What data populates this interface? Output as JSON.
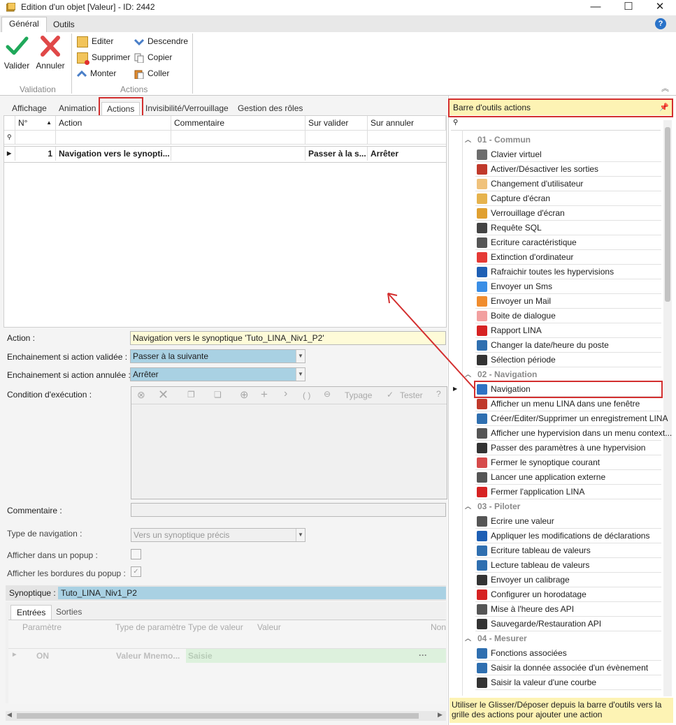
{
  "window": {
    "title": "Edition d'un objet [Valeur] - ID: 2442",
    "minimize": "—",
    "maximize": "☐",
    "close": "✕"
  },
  "ribbon": {
    "tabs": [
      "Général",
      "Outils"
    ],
    "help": "?",
    "validation": {
      "valider": "Valider",
      "annuler": "Annuler",
      "group": "Validation"
    },
    "actions": {
      "editer": "Editer",
      "supprimer": "Supprimer",
      "monter": "Monter",
      "descendre": "Descendre",
      "copier": "Copier",
      "coller": "Coller",
      "group": "Actions"
    }
  },
  "tabs": [
    "Affichage",
    "Animation",
    "Actions",
    "Invisibilité/Verrouillage",
    "Gestion des rôles"
  ],
  "grid": {
    "headers": [
      "N°",
      "Action",
      "Commentaire",
      "Sur valider",
      "Sur annuler"
    ],
    "row": {
      "num": "1",
      "action": "Navigation vers le synopti...",
      "commentaire": "",
      "sur_valider": "Passer à la s...",
      "sur_annuler": "Arrêter"
    }
  },
  "form": {
    "action_label": "Action :",
    "action_value": "Navigation vers le synoptique 'Tuto_LINA_Niv1_P2'",
    "ench_valid_label": "Enchainement si action validée :",
    "ench_valid_value": "Passer à la suivante",
    "ench_annul_label": "Enchainement si action annulée :",
    "ench_annul_value": "Arrêter",
    "condition_label": "Condition d'exécution :",
    "cond_toolbar": {
      "paren": "( )",
      "typage": "Typage",
      "tester": "Tester"
    },
    "commentaire_label": "Commentaire :",
    "type_nav_label": "Type de navigation :",
    "type_nav_value": "Vers un synoptique précis",
    "popup_label": "Afficher dans un popup :",
    "bordures_label": "Afficher les bordures du popup :",
    "synoptique_label": "Synoptique :",
    "synoptique_value": "Tuto_LINA_Niv1_P2",
    "subtabs": [
      "Entrées",
      "Sorties"
    ],
    "params_headers": [
      "Paramètre",
      "Type de paramètre",
      "Type de valeur",
      "Valeur",
      "Non"
    ],
    "params_row": {
      "param": "ON",
      "type_param": "Valeur Mnemo...",
      "type_valeur": "Saisie",
      "valeur": "",
      "more": "···"
    }
  },
  "panel": {
    "title": "Barre d'outils actions",
    "footer": "Utiliser le Glisser/Déposer depuis la barre d'outils vers la grille des actions pour ajouter une action",
    "categories": [
      {
        "name": "01 - Commun",
        "items": [
          {
            "label": "Clavier virtuel",
            "icon": "keyboard-icon",
            "color": "#6d6d6d"
          },
          {
            "label": "Activer/Désactiver les sorties",
            "icon": "gear-toggle-icon",
            "color": "#c0392b"
          },
          {
            "label": "Changement d'utilisateur",
            "icon": "user-icon",
            "color": "#f0c27b"
          },
          {
            "label": "Capture d'écran",
            "icon": "camera-icon",
            "color": "#e6b34d"
          },
          {
            "label": "Verrouillage d'écran",
            "icon": "lock-icon",
            "color": "#e0a030"
          },
          {
            "label": "Requête SQL",
            "icon": "database-icon",
            "color": "#444444"
          },
          {
            "label": "Ecriture caractéristique",
            "icon": "table-icon",
            "color": "#555555"
          },
          {
            "label": "Extinction d'ordinateur",
            "icon": "power-icon",
            "color": "#e53935"
          },
          {
            "label": "Rafraichir toutes les hypervisions",
            "icon": "refresh-icon",
            "color": "#1e5fb4"
          },
          {
            "label": "Envoyer un Sms",
            "icon": "sms-icon",
            "color": "#3a8ee6"
          },
          {
            "label": "Envoyer un Mail",
            "icon": "mail-icon",
            "color": "#f08c2e"
          },
          {
            "label": "Boite de dialogue",
            "icon": "dialog-icon",
            "color": "#f2a0a0"
          },
          {
            "label": "Rapport LINA",
            "icon": "pdf-icon",
            "color": "#d62222"
          },
          {
            "label": "Changer la date/heure du poste",
            "icon": "clock-icon",
            "color": "#2f6fb0"
          },
          {
            "label": "Sélection période",
            "icon": "cross-tools-icon",
            "color": "#333333"
          }
        ]
      },
      {
        "name": "02 - Navigation",
        "items": [
          {
            "label": "Navigation",
            "icon": "arrow-right-icon",
            "color": "#2f72c4"
          },
          {
            "label": "Afficher un menu LINA dans une fenêtre",
            "icon": "cross-tools-icon",
            "color": "#c0392b"
          },
          {
            "label": "Créer/Editer/Supprimer un enregistrement LINA",
            "icon": "form-icon",
            "color": "#2f6fb0"
          },
          {
            "label": "Afficher une hypervision dans un menu context...",
            "icon": "context-menu-icon",
            "color": "#555555"
          },
          {
            "label": "Passer des paramètres à une hypervision",
            "icon": "cross-tools-icon",
            "color": "#333333"
          },
          {
            "label": "Fermer le synoptique courant",
            "icon": "close-window-icon",
            "color": "#d64a4a"
          },
          {
            "label": "Lancer une application externe",
            "icon": "app-icon",
            "color": "#555555"
          },
          {
            "label": "Fermer l'application LINA",
            "icon": "exit-icon",
            "color": "#d62222"
          }
        ]
      },
      {
        "name": "03 - Piloter",
        "items": [
          {
            "label": "Ecrire une valeur",
            "icon": "write-value-icon",
            "color": "#555555"
          },
          {
            "label": "Appliquer les modifications de déclarations",
            "icon": "refresh-icon",
            "color": "#1e5fb4"
          },
          {
            "label": "Ecriture tableau de valeurs",
            "icon": "table-write-icon",
            "color": "#2f6fb0"
          },
          {
            "label": "Lecture tableau de valeurs",
            "icon": "table-read-icon",
            "color": "#2f6fb0"
          },
          {
            "label": "Envoyer un calibrage",
            "icon": "pen-icon",
            "color": "#333333"
          },
          {
            "label": "Configurer un horodatage",
            "icon": "clock-icon",
            "color": "#d62222"
          },
          {
            "label": "Mise à l'heure des API",
            "icon": "plc-clock-icon",
            "color": "#555555"
          },
          {
            "label": "Sauvegarde/Restauration API",
            "icon": "save-icon",
            "color": "#333333"
          }
        ]
      },
      {
        "name": "04 - Mesurer",
        "items": [
          {
            "label": "Fonctions associées",
            "icon": "bar-chart-icon",
            "color": "#2f6fb0"
          },
          {
            "label": "Saisir la donnée associée d'un évènement",
            "icon": "event-data-icon",
            "color": "#2f6fb0"
          },
          {
            "label": "Saisir la valeur d'une courbe",
            "icon": "cross-tools-icon",
            "color": "#333333"
          }
        ]
      }
    ]
  },
  "colors": {
    "accent_red": "#d32f2f",
    "panel_header_bg": "#fdf3b4",
    "action_field_bg": "#fefbd8",
    "select_bg": "#a9d1e3",
    "saisie_bg": "#ddf1dd"
  }
}
